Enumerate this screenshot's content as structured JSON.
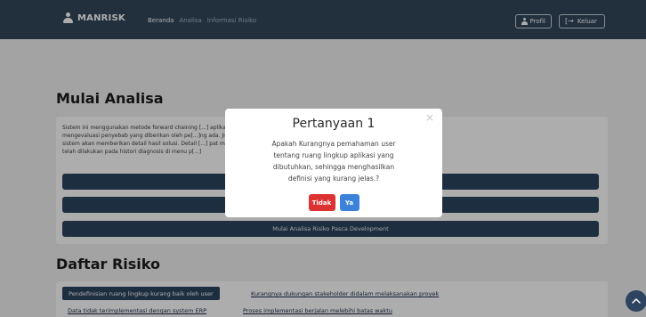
{
  "navbar": {
    "brand": "MANRISK",
    "links": [
      "Beranda",
      "Analisa",
      "Informasi Risiko"
    ],
    "profile_label": "Profil",
    "logout_label": "Keluar"
  },
  "analisa": {
    "title": "Mulai Analisa",
    "intro_lines": [
      "Sistem ini menggunakan metode forward chaining [...] aplikasi. Proses dimulai dengan",
      "mengevaluasi penyebab yang diberikan oleh pe[...]ng ada. Jika terdapat aturan yang terpenuhi,",
      "sistem akan memberikan detail hasil solusi. Detail [...] pat melihat kembali detail hasil analisa yang",
      "telah dilakukan pada histori diagnosis di menu p[...]"
    ],
    "buttons": [
      "",
      "",
      "Mulai Analisa Risiko Pasca Development"
    ]
  },
  "risiko": {
    "title": "Daftar Risiko",
    "highlighted": "Pendefinisian ruang lingkup kurang baik oleh user",
    "links": [
      "Kurangnya dukungan stakeholder didalam melaksanakan proyek",
      "Data tidak terimplementasi dengan system ERP",
      "Proses implementasi berjalan melebihi batas waktu"
    ]
  },
  "modal": {
    "title": "Pertanyaan 1",
    "close_glyph": "×",
    "question": "Apakah Kurangnya pemahaman user tentang ruang lingkup aplikasi yang dibutuhkan, sehingga menghasilkan definisi yang kurang jelas.?",
    "no_label": "Tidak",
    "yes_label": "Ya"
  },
  "colors": {
    "navbar": "#33475c",
    "primary": "#2d4461",
    "danger": "#dc3232",
    "info": "#3b82d8"
  },
  "icons": [
    "user-icon",
    "user-icon",
    "sign-out-icon",
    "chevron-up-icon"
  ]
}
